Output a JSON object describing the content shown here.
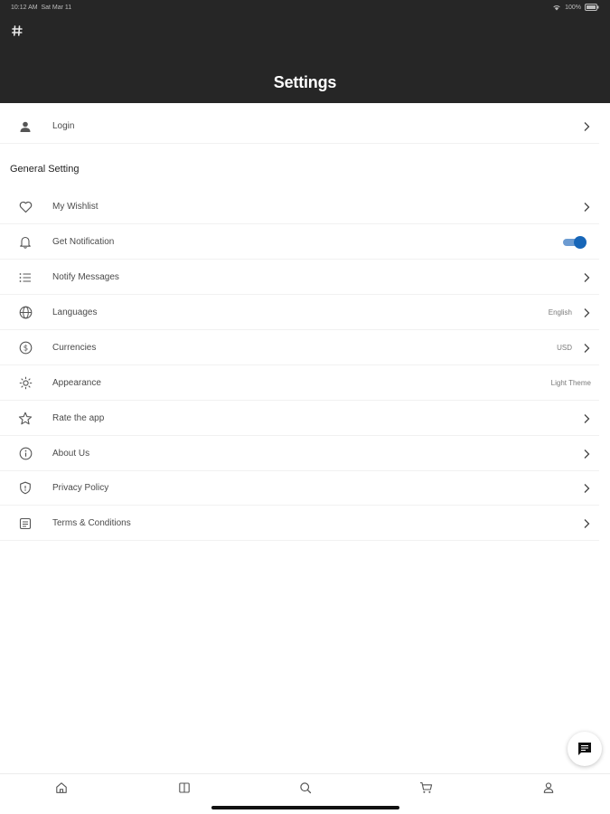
{
  "status_bar": {
    "time": "10:12 AM",
    "date": "Sat Mar 11",
    "battery": "100%"
  },
  "header": {
    "title": "Settings"
  },
  "login": {
    "label": "Login"
  },
  "general": {
    "title": "General Setting",
    "items": [
      {
        "label": "My Wishlist",
        "icon": "heart-icon"
      },
      {
        "label": "Get Notification",
        "icon": "bell-icon",
        "toggle_on": true
      },
      {
        "label": "Notify Messages",
        "icon": "list-icon"
      },
      {
        "label": "Languages",
        "icon": "globe-icon",
        "value": "English"
      },
      {
        "label": "Currencies",
        "icon": "dollar-icon",
        "value": "USD"
      },
      {
        "label": "Appearance",
        "icon": "sun-icon",
        "value": "Light Theme"
      },
      {
        "label": "Rate the app",
        "icon": "star-icon"
      },
      {
        "label": "About Us",
        "icon": "info-icon"
      },
      {
        "label": "Privacy Policy",
        "icon": "shield-icon"
      },
      {
        "label": "Terms & Conditions",
        "icon": "document-icon"
      }
    ]
  },
  "colors": {
    "header_bg": "#262626",
    "toggle_accent": "#1766b8"
  },
  "bottom_nav": [
    "home-icon",
    "book-icon",
    "search-icon",
    "cart-icon",
    "profile-icon"
  ]
}
